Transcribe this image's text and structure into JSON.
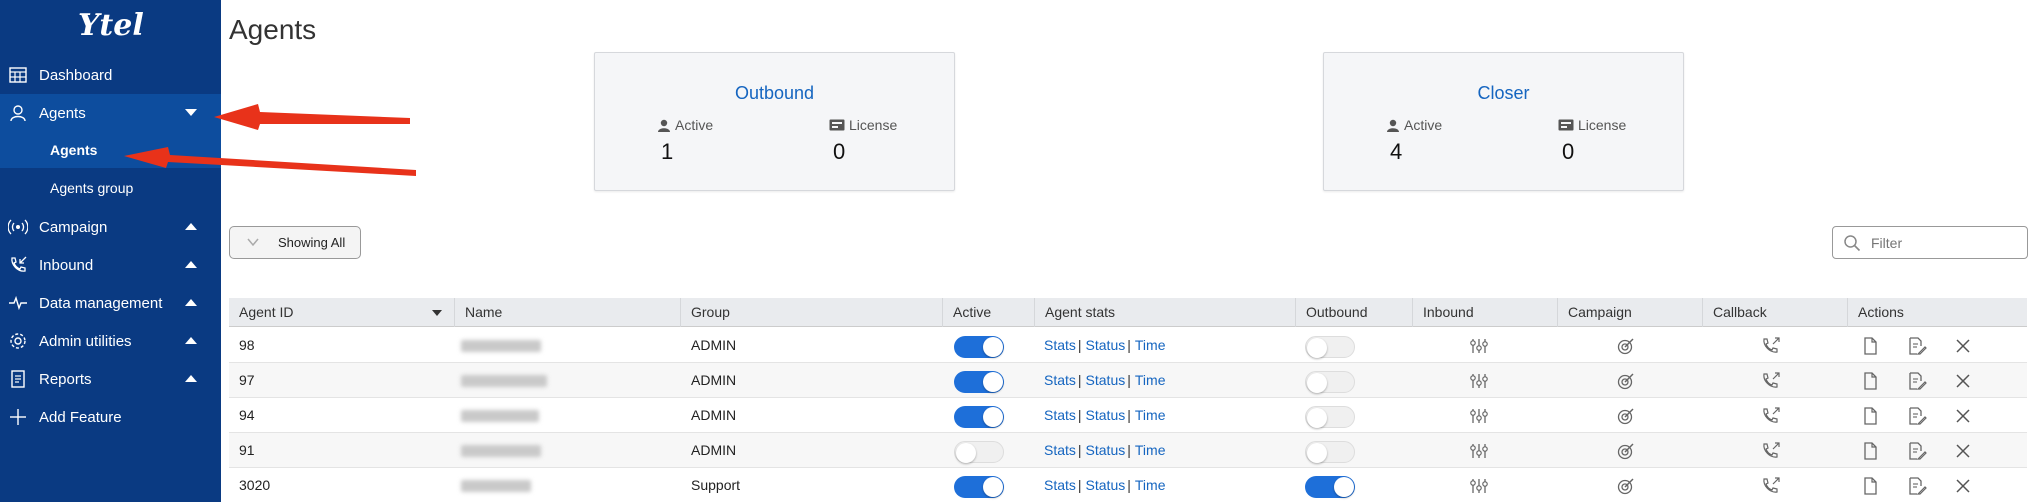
{
  "app": {
    "logo_text": "Ytel"
  },
  "sidebar": {
    "items": [
      {
        "label": "Dashboard",
        "icon": "dashboard-icon",
        "caret": "none"
      },
      {
        "label": "Agents",
        "icon": "agent-icon",
        "caret": "down"
      },
      {
        "label": "Campaign",
        "icon": "broadcast-icon",
        "caret": "up"
      },
      {
        "label": "Inbound",
        "icon": "incoming-call-icon",
        "caret": "up"
      },
      {
        "label": "Data management",
        "icon": "pulse-icon",
        "caret": "up"
      },
      {
        "label": "Admin utilities",
        "icon": "gear-icon",
        "caret": "up"
      },
      {
        "label": "Reports",
        "icon": "report-icon",
        "caret": "up"
      },
      {
        "label": "Add Feature",
        "icon": "plus-icon",
        "caret": "none"
      }
    ],
    "subitems": [
      {
        "label": "Agents",
        "selected": true
      },
      {
        "label": "Agents group",
        "selected": false
      }
    ]
  },
  "page": {
    "title": "Agents"
  },
  "cards": [
    {
      "title": "Outbound",
      "active_label": "Active",
      "active_value": "1",
      "license_label": "License",
      "license_value": "0"
    },
    {
      "title": "Closer",
      "active_label": "Active",
      "active_value": "4",
      "license_label": "License",
      "license_value": "0"
    }
  ],
  "toolbar": {
    "showing_label": "Showing All",
    "filter_placeholder": "Filter"
  },
  "table": {
    "headers": [
      "Agent ID",
      "Name",
      "Group",
      "Active",
      "Agent stats",
      "Outbound",
      "Inbound",
      "Campaign",
      "Callback",
      "Actions"
    ],
    "stats_links": [
      "Stats",
      "Status",
      "Time"
    ],
    "separator": "|",
    "rows": [
      {
        "agent_id": "98",
        "group": "ADMIN",
        "active": true,
        "outbound": false
      },
      {
        "agent_id": "97",
        "group": "ADMIN",
        "active": true,
        "outbound": false
      },
      {
        "agent_id": "94",
        "group": "ADMIN",
        "active": true,
        "outbound": false
      },
      {
        "agent_id": "91",
        "group": "ADMIN",
        "active": false,
        "outbound": false
      },
      {
        "agent_id": "3020",
        "group": "Support",
        "active": true,
        "outbound": true
      }
    ]
  },
  "colors": {
    "sidebar_bg": "#0a3a82",
    "sidebar_active": "#0d4d9e",
    "link": "#1565c0",
    "toggle_on": "#1e6fd9",
    "annotation_arrow": "#e8321a"
  }
}
